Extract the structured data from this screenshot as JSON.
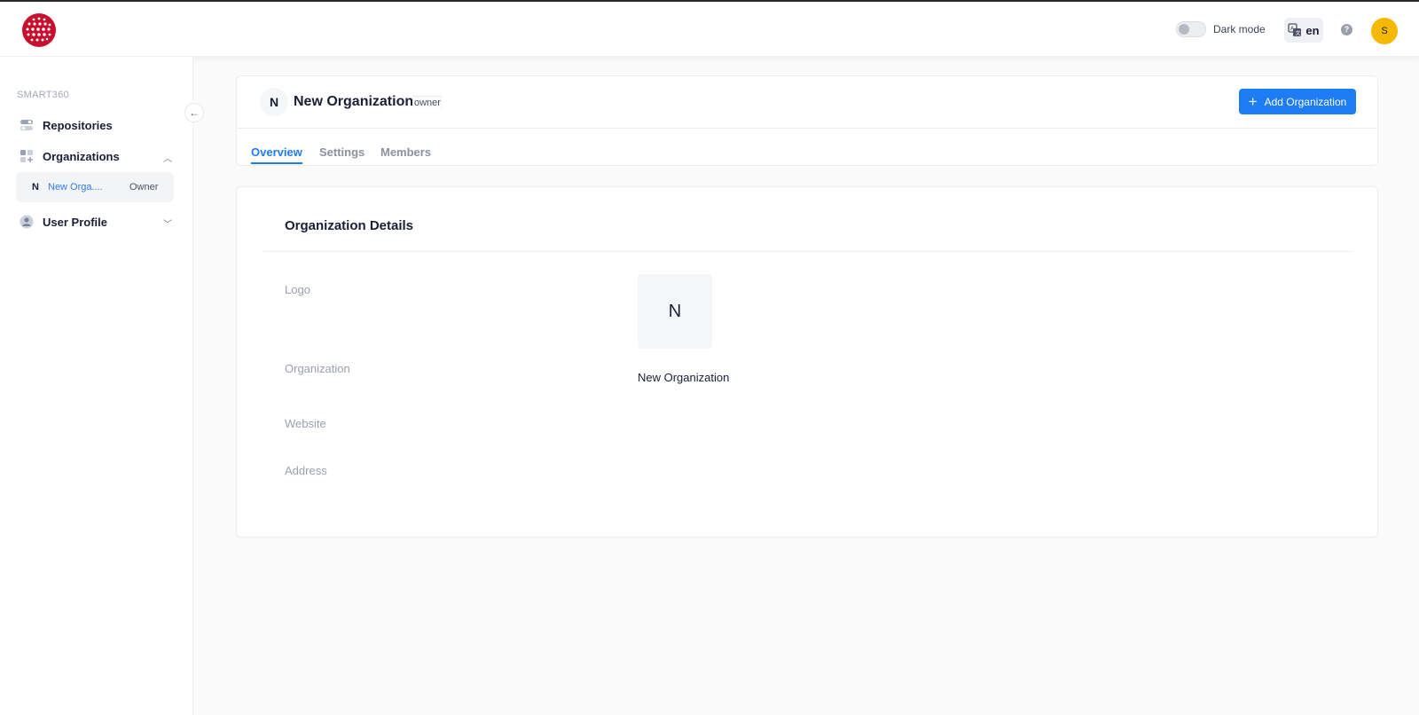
{
  "header": {
    "dark_mode_label": "Dark mode",
    "language_code": "en",
    "help_symbol": "?",
    "avatar_initial": "S"
  },
  "sidebar": {
    "section_title": "SMART360",
    "items": [
      {
        "label": "Repositories",
        "icon": "repositories-icon"
      },
      {
        "label": "Organizations",
        "icon": "organizations-icon",
        "expanded": true
      },
      {
        "label": "User Profile",
        "icon": "user-profile-icon",
        "expanded": false
      }
    ],
    "org_sub_item": {
      "initial": "N",
      "name": "New Orga....",
      "role": "Owner"
    }
  },
  "org_header": {
    "initial": "N",
    "title": "New Organization",
    "badge": "owner",
    "add_button_label": "Add Organization",
    "tabs": [
      "Overview",
      "Settings",
      "Members"
    ],
    "active_tab": "Overview"
  },
  "details": {
    "title": "Organization Details",
    "logo_label": "Logo",
    "logo_initial": "N",
    "organization_label": "Organization",
    "organization_value": "New Organization",
    "website_label": "Website",
    "address_label": "Address"
  },
  "colors": {
    "accent": "#1e7cf5",
    "avatar": "#f6b800",
    "brand": "#c8102e"
  }
}
